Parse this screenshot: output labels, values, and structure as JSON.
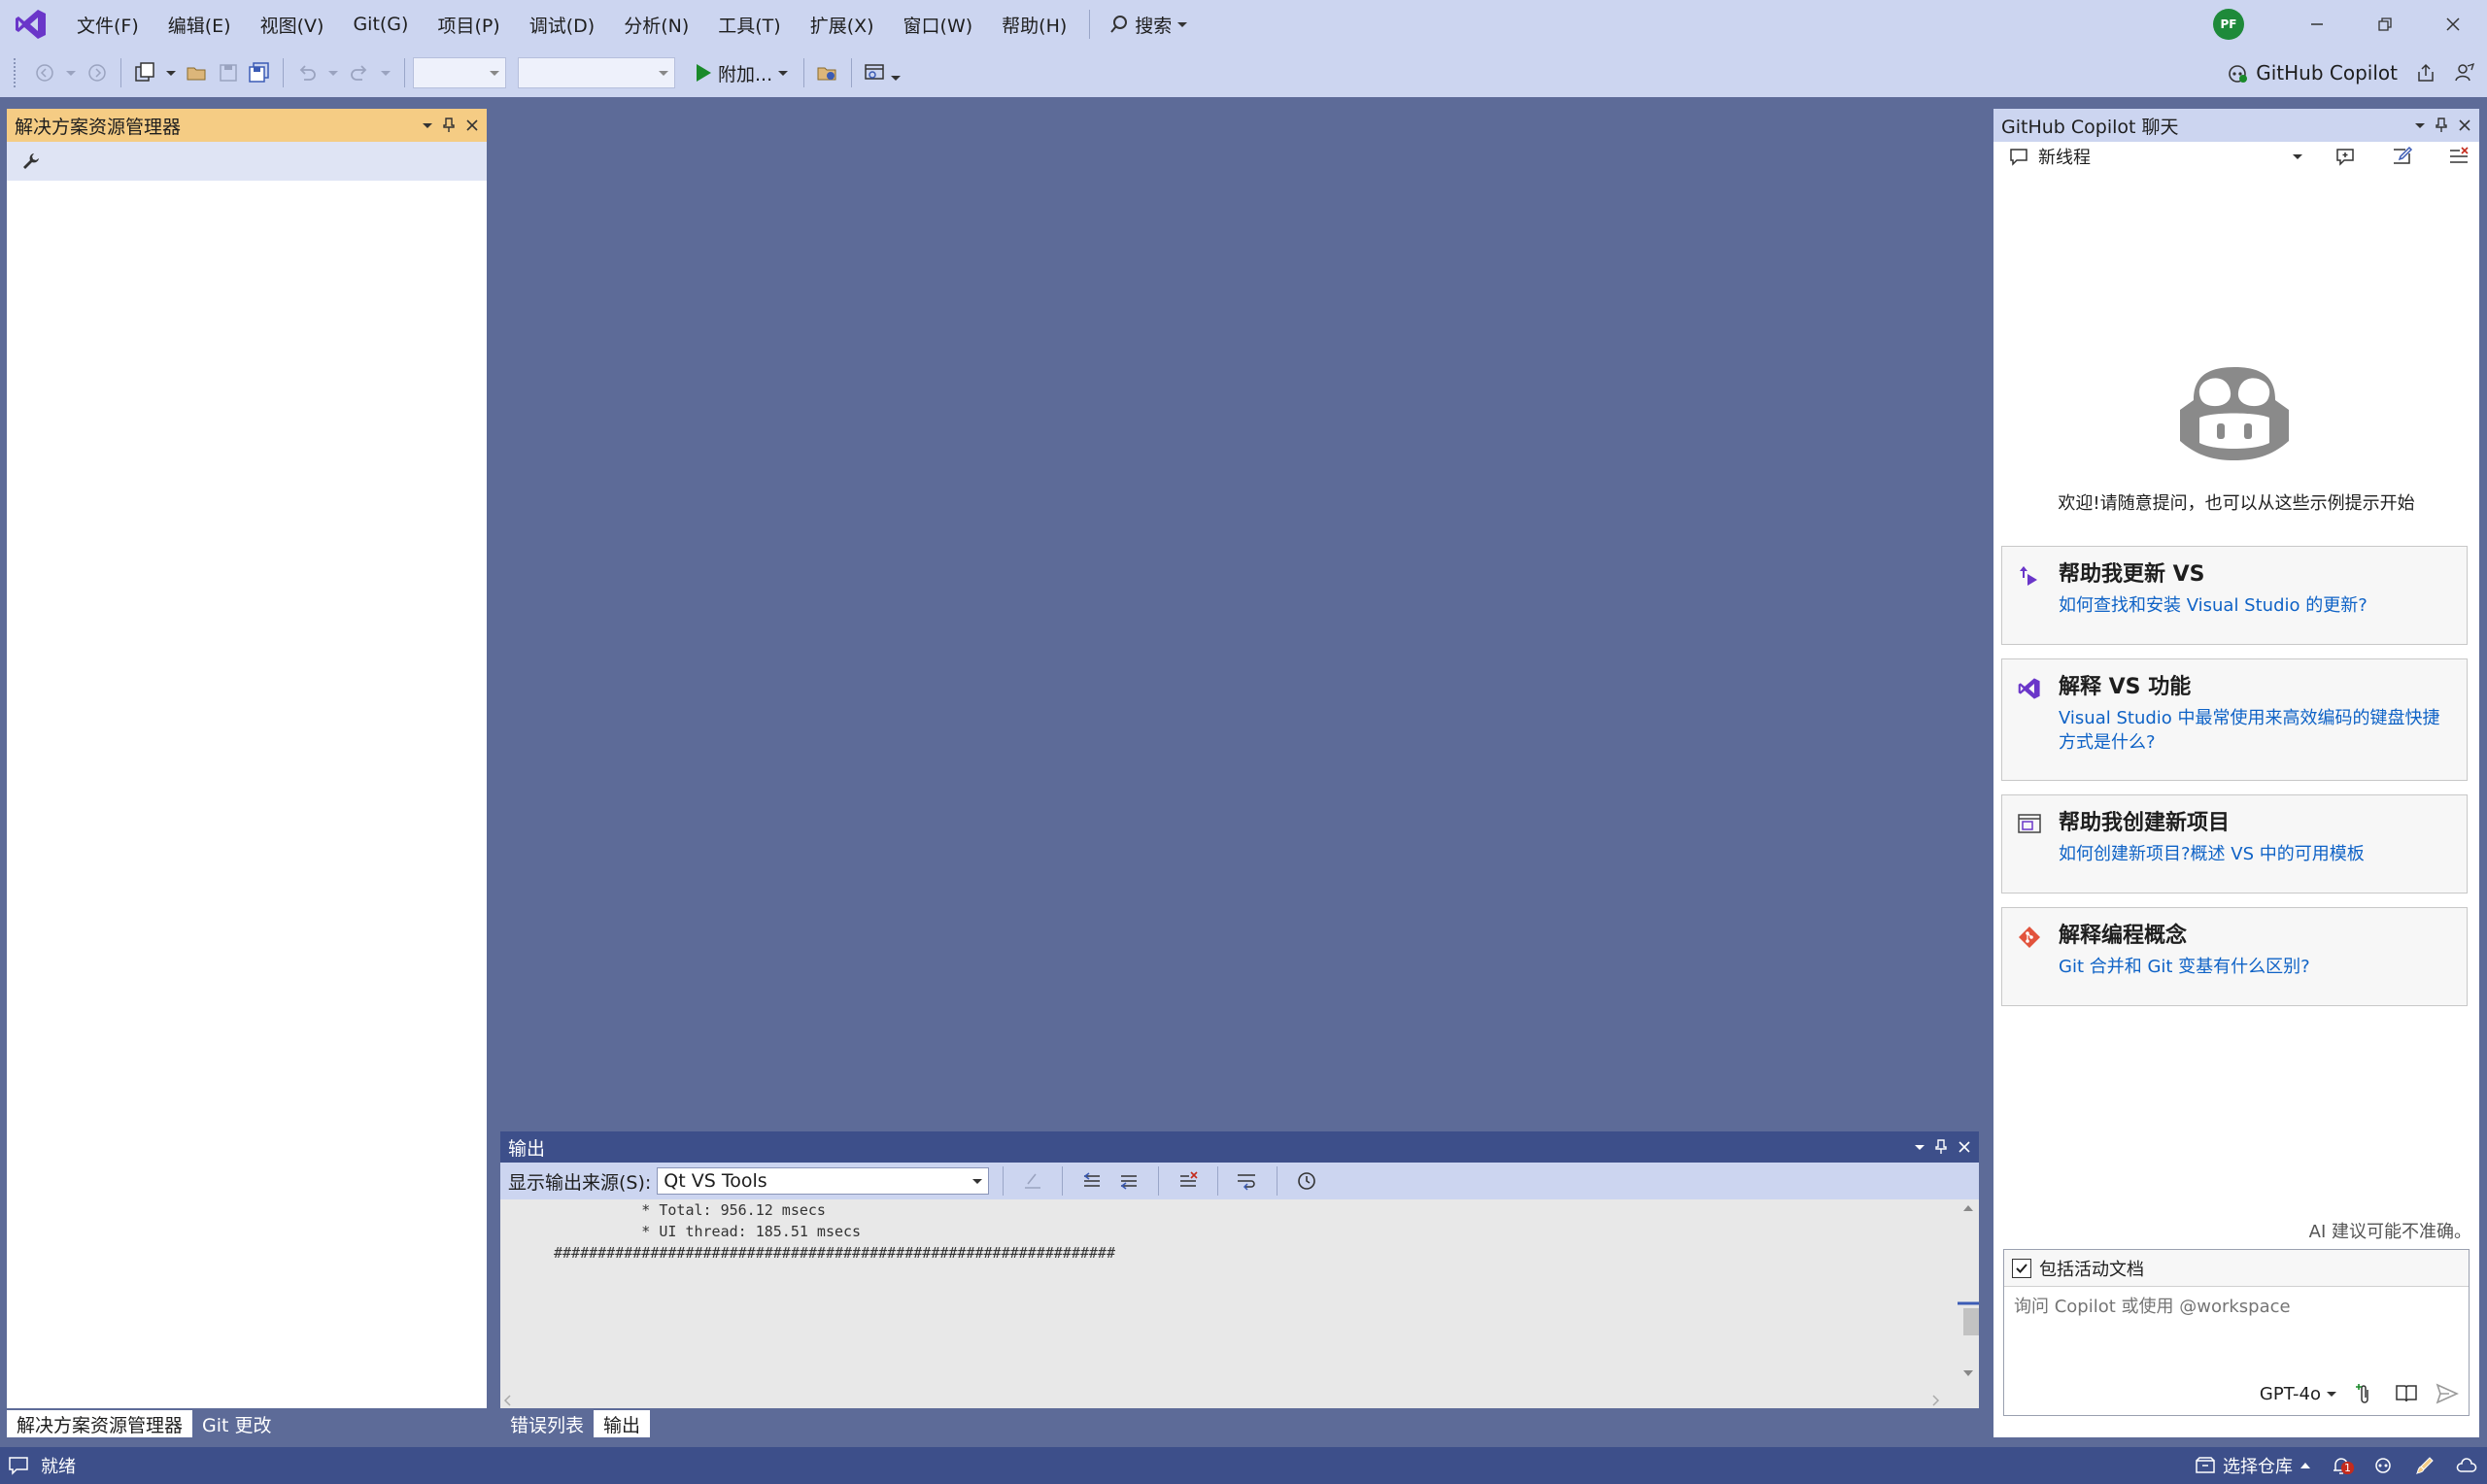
{
  "menu": [
    "文件(F)",
    "编辑(E)",
    "视图(V)",
    "Git(G)",
    "项目(P)",
    "调试(D)",
    "分析(N)",
    "工具(T)",
    "扩展(X)",
    "窗口(W)",
    "帮助(H)"
  ],
  "search_label": "搜索",
  "avatar_initials": "PF",
  "toolbar": {
    "attach_label": "附加...",
    "copilot_label": "GitHub Copilot"
  },
  "solution_explorer": {
    "title": "解决方案资源管理器",
    "tabs": [
      "解决方案资源管理器",
      "Git 更改"
    ]
  },
  "output": {
    "title": "输出",
    "source_label": "显示输出来源(S):",
    "source_value": "Qt VS Tools",
    "lines": [
      "          * Total: 956.12 msecs",
      "          * UI thread: 185.51 msecs",
      "################################################################"
    ],
    "tabs": [
      "错误列表",
      "输出"
    ]
  },
  "copilot": {
    "title": "GitHub Copilot 聊天",
    "thread_label": "新线程",
    "welcome": "欢迎!请随意提问，也可以从这些示例提示开始",
    "cards": [
      {
        "icon": "update-icon",
        "title": "帮助我更新 VS",
        "desc": "如何查找和安装 Visual Studio 的更新?"
      },
      {
        "icon": "vs-logo-icon",
        "title": "解释 VS 功能",
        "desc": "Visual Studio 中最常使用来高效编码的键盘快捷方式是什么?"
      },
      {
        "icon": "new-project-icon",
        "title": "帮助我创建新项目",
        "desc": "如何创建新项目?概述 VS 中的可用模板"
      },
      {
        "icon": "git-icon",
        "title": "解释编程概念",
        "desc": "Git 合并和 Git 变基有什么区别?"
      }
    ],
    "disclaimer": "AI 建议可能不准确。",
    "include_label": "包括活动文档",
    "input_placeholder": "询问 Copilot 或使用 @workspace",
    "model": "GPT-4o"
  },
  "status": {
    "ready": "就绪",
    "repo_label": "选择仓库",
    "notification_count": "1"
  },
  "colors": {
    "accent": "#3d4f8a",
    "chrome": "#ccd5f0",
    "workspace": "#5d6b98",
    "active_panel": "#f5cc84",
    "link": "#0e62c6"
  }
}
